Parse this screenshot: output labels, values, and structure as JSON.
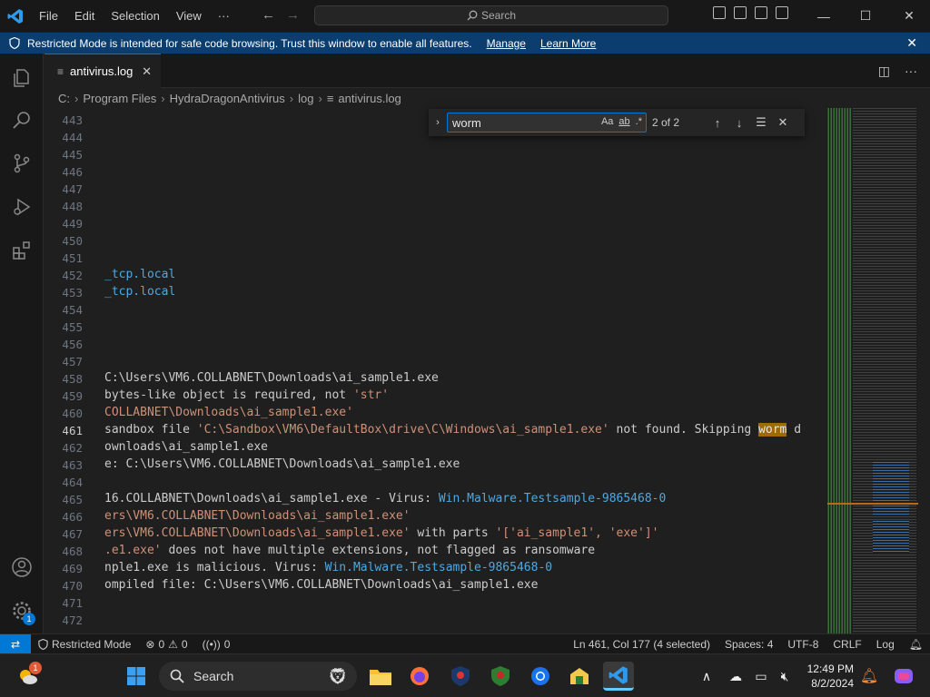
{
  "titlebar": {
    "menu": [
      "File",
      "Edit",
      "Selection",
      "View",
      "···"
    ],
    "search_placeholder": "Search"
  },
  "banner": {
    "message": "Restricted Mode is intended for safe code browsing. Trust this window to enable all features.",
    "manage": "Manage",
    "learn_more": "Learn More"
  },
  "tab": {
    "label": "antivirus.log",
    "close": "✕"
  },
  "breadcrumb": [
    "C:",
    "Program Files",
    "HydraDragonAntivirus",
    "log",
    "antivirus.log"
  ],
  "find": {
    "query": "worm",
    "case_label": "Aa",
    "word_label": "ab",
    "regex_label": ".*",
    "count": "2 of 2"
  },
  "editor": {
    "line_numbers": [
      "443",
      "444",
      "445",
      "446",
      "447",
      "448",
      "449",
      "450",
      "451",
      "452",
      "453",
      "454",
      "455",
      "456",
      "457",
      "458",
      "459",
      "460",
      "461",
      "462",
      "463",
      "464",
      "465",
      "466",
      "467",
      "468",
      "469",
      "470",
      "471",
      "472"
    ],
    "active_line": "461",
    "lines": {
      "452": "_tcp.local",
      "453": "_tcp.local",
      "458": "C:\\Users\\VM6.COLLABNET\\Downloads\\ai_sample1.exe",
      "459a": "bytes-like object is required, not ",
      "459b": "'str'",
      "460": "COLLABNET\\Downloads\\ai_sample1.exe'",
      "461a": "sandbox file ",
      "461b": "'C:\\Sandbox\\VM6\\DefaultBox\\drive\\C\\Windows\\ai_sample1.exe'",
      "461c": " not found. Skipping ",
      "461d": "worm",
      "461e": " d",
      "462": "ownloads\\ai_sample1.exe",
      "463": "e: C:\\Users\\VM6.COLLABNET\\Downloads\\ai_sample1.exe",
      "465a": "16.COLLABNET\\Downloads\\ai_sample1.exe - Virus: ",
      "465b": "Win.Malware.Testsample-9865468-0",
      "466": "ers\\VM6.COLLABNET\\Downloads\\ai_sample1.exe'",
      "467a": "ers\\VM6.COLLABNET\\Downloads\\ai_sample1.exe'",
      "467b": " with parts ",
      "467c": "'['ai_sample1', 'exe']'",
      "468a": ".e1.exe'",
      "468b": " does not have multiple extensions, not flagged as ransomware",
      "469a": "nple1.exe is malicious. Virus: ",
      "469b": "Win.Malware.Testsample-9865468-0",
      "470": "ompiled file: C:\\Users\\VM6.COLLABNET\\Downloads\\ai_sample1.exe"
    }
  },
  "statusbar": {
    "restricted": "Restricted Mode",
    "errors": "0",
    "warnings": "0",
    "ports": "0",
    "position": "Ln 461, Col 177 (4 selected)",
    "spaces": "Spaces: 4",
    "encoding": "UTF-8",
    "eol": "CRLF",
    "language": "Log"
  },
  "activity": {
    "settings_badge": "1"
  },
  "taskbar": {
    "search": "Search",
    "time": "12:49 PM",
    "date": "8/2/2024",
    "widget_badge": "1"
  },
  "colors": {
    "accent": "#0078d4",
    "banner": "#0b3d6e",
    "string": "#ce9178",
    "virus_name": "#4fa8e0",
    "find_highlight": "#9e6a03"
  }
}
